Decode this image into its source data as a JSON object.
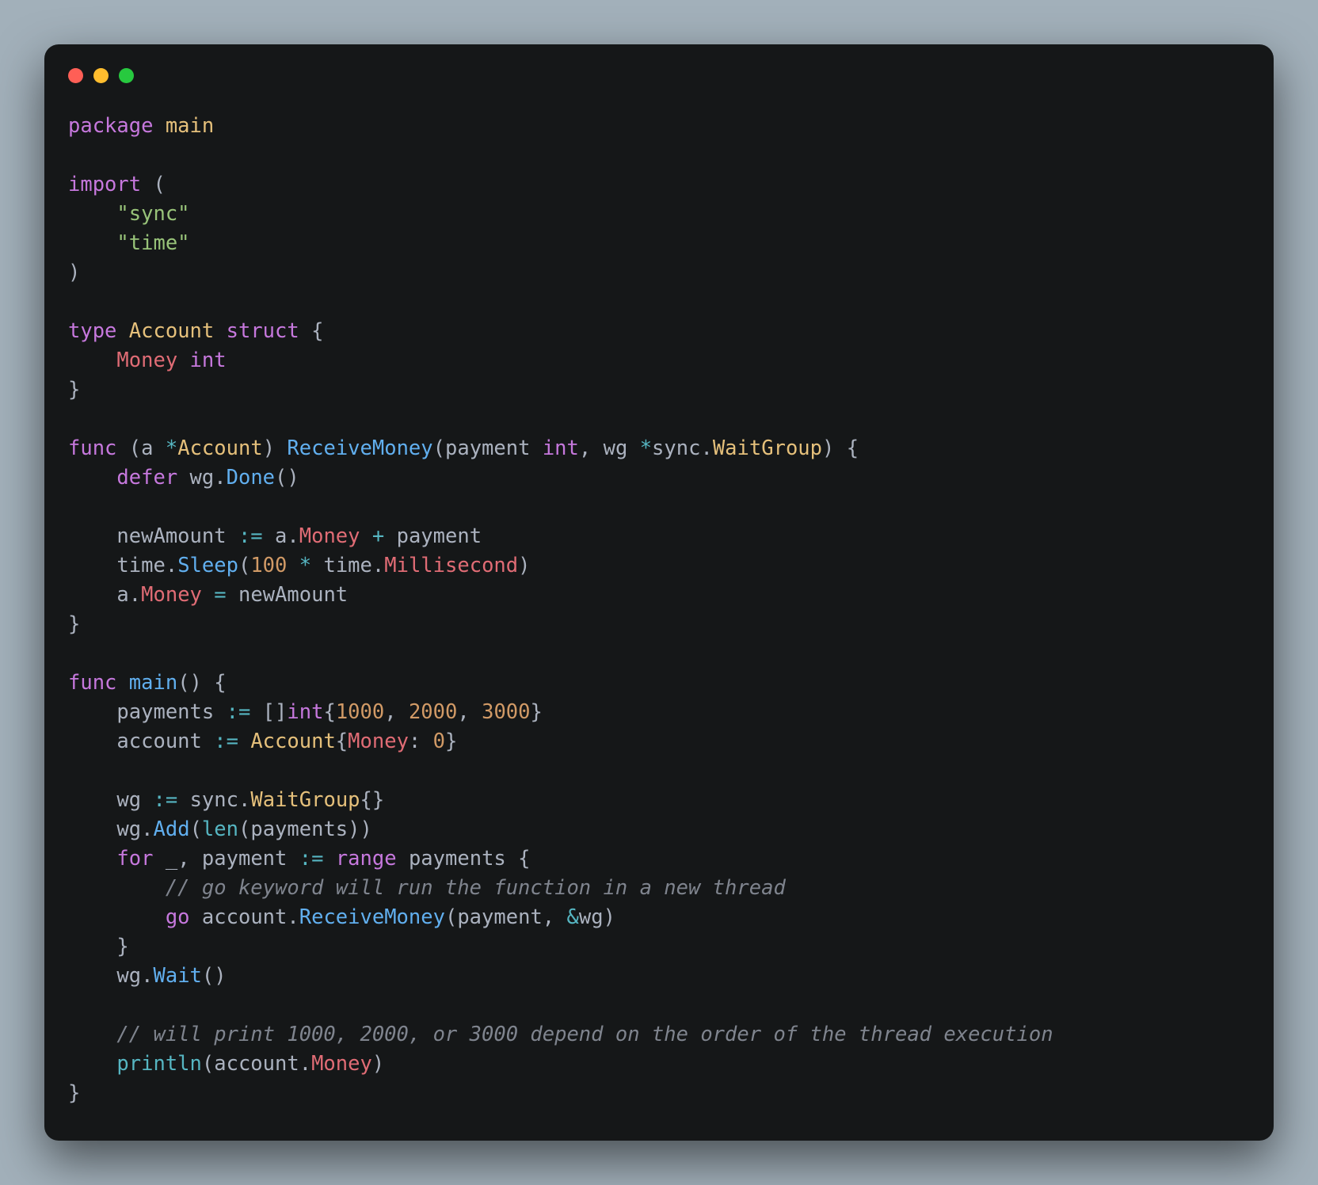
{
  "language": "go",
  "code": {
    "lines": [
      [
        {
          "c": "tok-kw",
          "t": "package"
        },
        {
          "c": "tok-punc",
          "t": " "
        },
        {
          "c": "tok-type",
          "t": "main"
        }
      ],
      [],
      [
        {
          "c": "tok-kw",
          "t": "import"
        },
        {
          "c": "tok-punc",
          "t": " ("
        }
      ],
      [
        {
          "c": "tok-punc",
          "t": "    "
        },
        {
          "c": "tok-str",
          "t": "\"sync\""
        }
      ],
      [
        {
          "c": "tok-punc",
          "t": "    "
        },
        {
          "c": "tok-str",
          "t": "\"time\""
        }
      ],
      [
        {
          "c": "tok-punc",
          "t": ")"
        }
      ],
      [],
      [
        {
          "c": "tok-kw",
          "t": "type"
        },
        {
          "c": "tok-punc",
          "t": " "
        },
        {
          "c": "tok-type",
          "t": "Account"
        },
        {
          "c": "tok-punc",
          "t": " "
        },
        {
          "c": "tok-kw",
          "t": "struct"
        },
        {
          "c": "tok-punc",
          "t": " {"
        }
      ],
      [
        {
          "c": "tok-punc",
          "t": "    "
        },
        {
          "c": "tok-field",
          "t": "Money"
        },
        {
          "c": "tok-punc",
          "t": " "
        },
        {
          "c": "tok-kw",
          "t": "int"
        }
      ],
      [
        {
          "c": "tok-punc",
          "t": "}"
        }
      ],
      [],
      [
        {
          "c": "tok-kw",
          "t": "func"
        },
        {
          "c": "tok-punc",
          "t": " ("
        },
        {
          "c": "tok-ident",
          "t": "a"
        },
        {
          "c": "tok-punc",
          "t": " "
        },
        {
          "c": "tok-op",
          "t": "*"
        },
        {
          "c": "tok-type",
          "t": "Account"
        },
        {
          "c": "tok-punc",
          "t": ") "
        },
        {
          "c": "tok-func",
          "t": "ReceiveMoney"
        },
        {
          "c": "tok-punc",
          "t": "("
        },
        {
          "c": "tok-ident",
          "t": "payment"
        },
        {
          "c": "tok-punc",
          "t": " "
        },
        {
          "c": "tok-kw",
          "t": "int"
        },
        {
          "c": "tok-punc",
          "t": ", "
        },
        {
          "c": "tok-ident",
          "t": "wg"
        },
        {
          "c": "tok-punc",
          "t": " "
        },
        {
          "c": "tok-op",
          "t": "*"
        },
        {
          "c": "tok-ident",
          "t": "sync"
        },
        {
          "c": "tok-punc",
          "t": "."
        },
        {
          "c": "tok-type",
          "t": "WaitGroup"
        },
        {
          "c": "tok-punc",
          "t": ") {"
        }
      ],
      [
        {
          "c": "tok-punc",
          "t": "    "
        },
        {
          "c": "tok-kw",
          "t": "defer"
        },
        {
          "c": "tok-punc",
          "t": " "
        },
        {
          "c": "tok-ident",
          "t": "wg"
        },
        {
          "c": "tok-punc",
          "t": "."
        },
        {
          "c": "tok-func",
          "t": "Done"
        },
        {
          "c": "tok-punc",
          "t": "()"
        }
      ],
      [],
      [
        {
          "c": "tok-punc",
          "t": "    "
        },
        {
          "c": "tok-ident",
          "t": "newAmount"
        },
        {
          "c": "tok-punc",
          "t": " "
        },
        {
          "c": "tok-op",
          "t": ":="
        },
        {
          "c": "tok-punc",
          "t": " "
        },
        {
          "c": "tok-ident",
          "t": "a"
        },
        {
          "c": "tok-punc",
          "t": "."
        },
        {
          "c": "tok-field",
          "t": "Money"
        },
        {
          "c": "tok-punc",
          "t": " "
        },
        {
          "c": "tok-op",
          "t": "+"
        },
        {
          "c": "tok-punc",
          "t": " "
        },
        {
          "c": "tok-ident",
          "t": "payment"
        }
      ],
      [
        {
          "c": "tok-punc",
          "t": "    "
        },
        {
          "c": "tok-ident",
          "t": "time"
        },
        {
          "c": "tok-punc",
          "t": "."
        },
        {
          "c": "tok-func",
          "t": "Sleep"
        },
        {
          "c": "tok-punc",
          "t": "("
        },
        {
          "c": "tok-num",
          "t": "100"
        },
        {
          "c": "tok-punc",
          "t": " "
        },
        {
          "c": "tok-op",
          "t": "*"
        },
        {
          "c": "tok-punc",
          "t": " "
        },
        {
          "c": "tok-ident",
          "t": "time"
        },
        {
          "c": "tok-punc",
          "t": "."
        },
        {
          "c": "tok-field",
          "t": "Millisecond"
        },
        {
          "c": "tok-punc",
          "t": ")"
        }
      ],
      [
        {
          "c": "tok-punc",
          "t": "    "
        },
        {
          "c": "tok-ident",
          "t": "a"
        },
        {
          "c": "tok-punc",
          "t": "."
        },
        {
          "c": "tok-field",
          "t": "Money"
        },
        {
          "c": "tok-punc",
          "t": " "
        },
        {
          "c": "tok-op",
          "t": "="
        },
        {
          "c": "tok-punc",
          "t": " "
        },
        {
          "c": "tok-ident",
          "t": "newAmount"
        }
      ],
      [
        {
          "c": "tok-punc",
          "t": "}"
        }
      ],
      [],
      [
        {
          "c": "tok-kw",
          "t": "func"
        },
        {
          "c": "tok-punc",
          "t": " "
        },
        {
          "c": "tok-func",
          "t": "main"
        },
        {
          "c": "tok-punc",
          "t": "() {"
        }
      ],
      [
        {
          "c": "tok-punc",
          "t": "    "
        },
        {
          "c": "tok-ident",
          "t": "payments"
        },
        {
          "c": "tok-punc",
          "t": " "
        },
        {
          "c": "tok-op",
          "t": ":="
        },
        {
          "c": "tok-punc",
          "t": " []"
        },
        {
          "c": "tok-kw",
          "t": "int"
        },
        {
          "c": "tok-punc",
          "t": "{"
        },
        {
          "c": "tok-num",
          "t": "1000"
        },
        {
          "c": "tok-punc",
          "t": ", "
        },
        {
          "c": "tok-num",
          "t": "2000"
        },
        {
          "c": "tok-punc",
          "t": ", "
        },
        {
          "c": "tok-num",
          "t": "3000"
        },
        {
          "c": "tok-punc",
          "t": "}"
        }
      ],
      [
        {
          "c": "tok-punc",
          "t": "    "
        },
        {
          "c": "tok-ident",
          "t": "account"
        },
        {
          "c": "tok-punc",
          "t": " "
        },
        {
          "c": "tok-op",
          "t": ":="
        },
        {
          "c": "tok-punc",
          "t": " "
        },
        {
          "c": "tok-type",
          "t": "Account"
        },
        {
          "c": "tok-punc",
          "t": "{"
        },
        {
          "c": "tok-field",
          "t": "Money"
        },
        {
          "c": "tok-punc",
          "t": ": "
        },
        {
          "c": "tok-num",
          "t": "0"
        },
        {
          "c": "tok-punc",
          "t": "}"
        }
      ],
      [],
      [
        {
          "c": "tok-punc",
          "t": "    "
        },
        {
          "c": "tok-ident",
          "t": "wg"
        },
        {
          "c": "tok-punc",
          "t": " "
        },
        {
          "c": "tok-op",
          "t": ":="
        },
        {
          "c": "tok-punc",
          "t": " "
        },
        {
          "c": "tok-ident",
          "t": "sync"
        },
        {
          "c": "tok-punc",
          "t": "."
        },
        {
          "c": "tok-type",
          "t": "WaitGroup"
        },
        {
          "c": "tok-punc",
          "t": "{}"
        }
      ],
      [
        {
          "c": "tok-punc",
          "t": "    "
        },
        {
          "c": "tok-ident",
          "t": "wg"
        },
        {
          "c": "tok-punc",
          "t": "."
        },
        {
          "c": "tok-func",
          "t": "Add"
        },
        {
          "c": "tok-punc",
          "t": "("
        },
        {
          "c": "tok-builtin",
          "t": "len"
        },
        {
          "c": "tok-punc",
          "t": "("
        },
        {
          "c": "tok-ident",
          "t": "payments"
        },
        {
          "c": "tok-punc",
          "t": "))"
        }
      ],
      [
        {
          "c": "tok-punc",
          "t": "    "
        },
        {
          "c": "tok-kw",
          "t": "for"
        },
        {
          "c": "tok-punc",
          "t": " "
        },
        {
          "c": "tok-ident",
          "t": "_"
        },
        {
          "c": "tok-punc",
          "t": ", "
        },
        {
          "c": "tok-ident",
          "t": "payment"
        },
        {
          "c": "tok-punc",
          "t": " "
        },
        {
          "c": "tok-op",
          "t": ":="
        },
        {
          "c": "tok-punc",
          "t": " "
        },
        {
          "c": "tok-kw",
          "t": "range"
        },
        {
          "c": "tok-punc",
          "t": " "
        },
        {
          "c": "tok-ident",
          "t": "payments"
        },
        {
          "c": "tok-punc",
          "t": " {"
        }
      ],
      [
        {
          "c": "tok-punc",
          "t": "        "
        },
        {
          "c": "tok-comment",
          "t": "// go keyword will run the function in a new thread"
        }
      ],
      [
        {
          "c": "tok-punc",
          "t": "        "
        },
        {
          "c": "tok-kw",
          "t": "go"
        },
        {
          "c": "tok-punc",
          "t": " "
        },
        {
          "c": "tok-ident",
          "t": "account"
        },
        {
          "c": "tok-punc",
          "t": "."
        },
        {
          "c": "tok-func",
          "t": "ReceiveMoney"
        },
        {
          "c": "tok-punc",
          "t": "("
        },
        {
          "c": "tok-ident",
          "t": "payment"
        },
        {
          "c": "tok-punc",
          "t": ", "
        },
        {
          "c": "tok-op",
          "t": "&"
        },
        {
          "c": "tok-ident",
          "t": "wg"
        },
        {
          "c": "tok-punc",
          "t": ")"
        }
      ],
      [
        {
          "c": "tok-punc",
          "t": "    }"
        }
      ],
      [
        {
          "c": "tok-punc",
          "t": "    "
        },
        {
          "c": "tok-ident",
          "t": "wg"
        },
        {
          "c": "tok-punc",
          "t": "."
        },
        {
          "c": "tok-func",
          "t": "Wait"
        },
        {
          "c": "tok-punc",
          "t": "()"
        }
      ],
      [],
      [
        {
          "c": "tok-punc",
          "t": "    "
        },
        {
          "c": "tok-comment",
          "t": "// will print 1000, 2000, or 3000 depend on the order of the thread execution"
        }
      ],
      [
        {
          "c": "tok-punc",
          "t": "    "
        },
        {
          "c": "tok-builtin",
          "t": "println"
        },
        {
          "c": "tok-punc",
          "t": "("
        },
        {
          "c": "tok-ident",
          "t": "account"
        },
        {
          "c": "tok-punc",
          "t": "."
        },
        {
          "c": "tok-field",
          "t": "Money"
        },
        {
          "c": "tok-punc",
          "t": ")"
        }
      ],
      [
        {
          "c": "tok-punc",
          "t": "}"
        }
      ]
    ]
  }
}
